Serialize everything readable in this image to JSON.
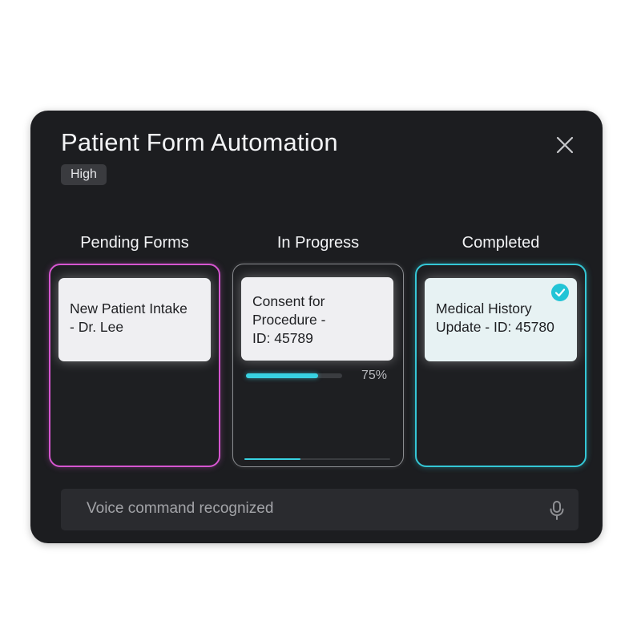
{
  "dialog": {
    "title": "Patient Form Automation",
    "priority_badge": "High",
    "close_icon": "close-icon"
  },
  "columns": [
    {
      "title": "Pending Forms",
      "accent": "#d656d0",
      "cards": [
        {
          "lines": [
            "New Patient Intake",
            "- Dr. Lee"
          ]
        }
      ]
    },
    {
      "title": "In Progress",
      "accent": "#8a8c90",
      "cards": [
        {
          "lines": [
            "Consent for",
            "Procedure -",
            "ID: 45789"
          ]
        }
      ],
      "progress": {
        "value": 0.75,
        "label": "75%"
      }
    },
    {
      "title": "Completed",
      "accent": "#34c7d6",
      "cards": [
        {
          "lines": [
            "Medical History",
            "Update - ID: 45780"
          ],
          "status_icon": "check-circle-icon"
        }
      ]
    }
  ],
  "voice": {
    "status_text": "Voice command recognized",
    "icon": "microphone-icon"
  },
  "colors": {
    "panel_bg": "#1c1d20",
    "progress_accent": "#38d2e2"
  }
}
